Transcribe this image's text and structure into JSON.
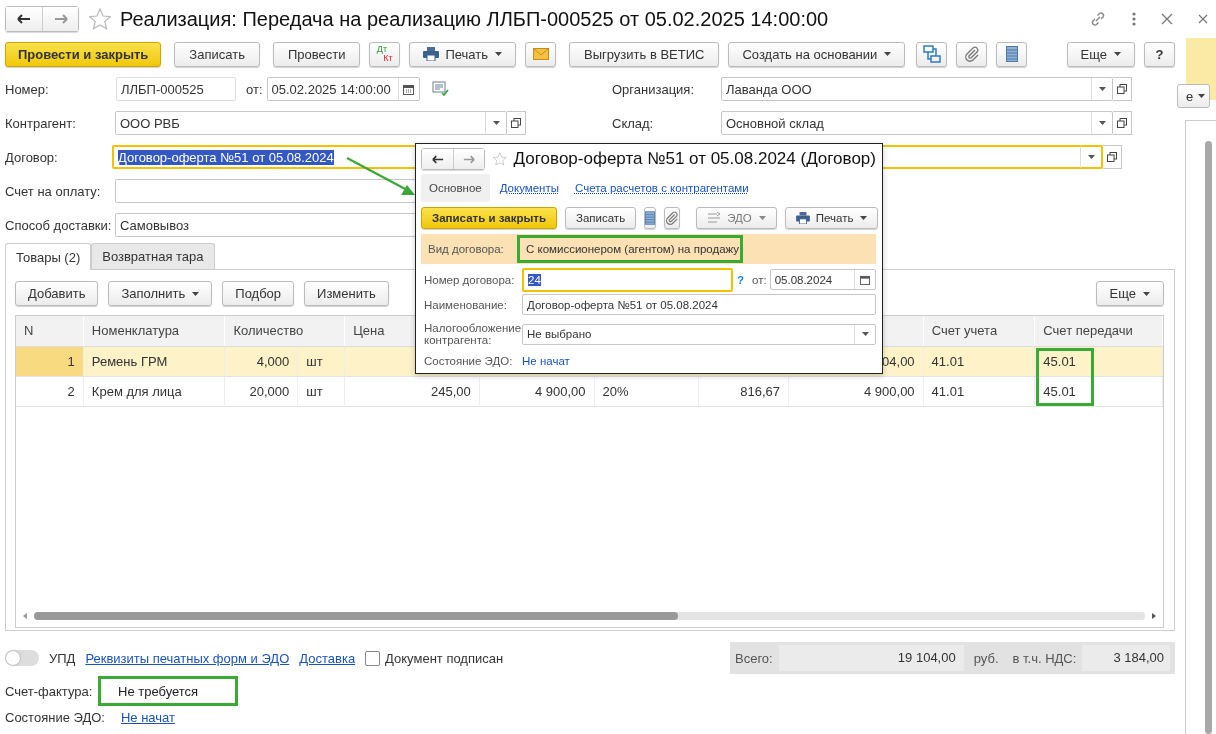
{
  "window": {
    "title": "Реализация: Передача на реализацию ЛЛБП-000525 от 05.02.2025 14:00:00"
  },
  "toolbar": [
    {
      "kind": "primary",
      "label": "Провести и закрыть"
    },
    {
      "kind": "button",
      "label": "Записать"
    },
    {
      "kind": "button",
      "label": "Провести"
    },
    {
      "kind": "dtkt",
      "label": "Дт",
      "label_2": "Кт"
    },
    {
      "kind": "print",
      "label": "Печать"
    },
    {
      "kind": "mail"
    },
    {
      "kind": "button",
      "label": "Выгрузить в ВЕТИС"
    },
    {
      "kind": "menu",
      "label": "Создать на основании"
    },
    {
      "kind": "structure"
    },
    {
      "kind": "clip"
    },
    {
      "kind": "list"
    }
  ],
  "toolbar_right": [
    {
      "kind": "menu",
      "label": "Еще"
    },
    {
      "kind": "button",
      "label": "?"
    }
  ],
  "header": {
    "number": {
      "label": "Номер:",
      "value": "ЛЛБП-000525"
    },
    "date": {
      "label": "от:",
      "value": "05.02.2025 14:00:00"
    },
    "counterparty": {
      "label": "Контрагент:",
      "value": "ООО РВБ"
    },
    "contract": {
      "label": "Договор:",
      "value": "Договор-оферта №51 от 05.08.2024",
      "focused": true,
      "text_selected": true
    },
    "invoice": {
      "label": "Счет на оплату:"
    },
    "delivery": {
      "label": "Способ доставки:",
      "value": "Самовывоз"
    },
    "organization": {
      "label": "Организация:",
      "value": "Лаванда ООО"
    },
    "warehouse": {
      "label": "Склад:",
      "value": "Основной склад"
    }
  },
  "tabs": [
    {
      "label": "Товары (2)",
      "selected": true
    },
    {
      "label": "Возвратная тара",
      "selected": false
    }
  ],
  "table_toolbar": [
    {
      "kind": "button",
      "label": "Добавить"
    },
    {
      "kind": "menu",
      "label": "Заполнить"
    },
    {
      "kind": "button",
      "label": "Подбор"
    },
    {
      "kind": "button",
      "label": "Изменить"
    }
  ],
  "table_toolbar_right": [
    {
      "kind": "menu",
      "label": "Еще"
    }
  ],
  "table": {
    "columns": [
      {
        "label": "N",
        "kind": "single"
      },
      {
        "label": "Номенклатура",
        "kind": "single"
      },
      {
        "label": "Количество",
        "kind": "double"
      },
      {
        "kind": "unit"
      },
      {
        "label": "Цена",
        "kind": "single"
      },
      {
        "kind": "single"
      },
      {
        "kind": "single"
      },
      {
        "kind": "single"
      },
      {
        "kind": "single"
      },
      {
        "label": "Счет учета",
        "kind": "single"
      },
      {
        "label": "Счет передачи",
        "kind": "single",
        "marked": true
      }
    ],
    "rows": [
      {
        "selected": true,
        "cells": [
          "1",
          "Ремень ГРМ",
          "4,000",
          "шт",
          null,
          null,
          null,
          null,
          "04,00",
          "41.01",
          "45.01"
        ]
      },
      {
        "selected": false,
        "cells": [
          "2",
          "Крем для лица",
          "20,000",
          "шт",
          "245,00",
          "4 900,00",
          "20%",
          "816,67",
          "4 900,00",
          "41.01",
          "45.01"
        ]
      }
    ]
  },
  "footer": {
    "upd": {
      "label": "УПД",
      "on": false
    },
    "links": [
      "Реквизиты печатных форм и ЭДО",
      "Доставка"
    ],
    "signed": {
      "label": "Документ подписан",
      "checked": false
    },
    "totals": {
      "label": "Всего:",
      "value": "19 104,00",
      "currency": "руб.",
      "vat_label": "в т.ч. НДС:",
      "vat": "3 184,00"
    },
    "invoice": {
      "label": "Счет-фактура:",
      "value": "Не требуется",
      "marked": true
    },
    "edo": {
      "label": "Состояние ЭДО:",
      "value": "Не начат"
    }
  },
  "popup": {
    "title": "Договор-оферта №51 от 05.08.2024 (Договор)",
    "tabs": [
      {
        "label": "Основное",
        "selected": true
      },
      {
        "label": "Документы",
        "selected": false
      },
      {
        "label": "Счета расчетов с контрагентами",
        "selected": false
      }
    ],
    "toolbar": [
      {
        "kind": "primary",
        "label": "Записать и закрыть"
      },
      {
        "kind": "button",
        "label": "Записать"
      },
      {
        "kind": "list"
      },
      {
        "kind": "clip"
      },
      {
        "kind": "edo",
        "label": "ЭДО"
      },
      {
        "kind": "print",
        "label": "Печать"
      }
    ],
    "kind_field": {
      "label": "Вид договора:",
      "value": "С комиссионером (агентом) на продажу",
      "marked": true
    },
    "number": {
      "label": "Номер договора:",
      "value": "24",
      "focused": true,
      "text_selected": true,
      "help": "?"
    },
    "date": {
      "label": "от:",
      "value": "05.08.2024"
    },
    "name": {
      "label": "Наименование:",
      "value": "Договор-оферта №51 от 05.08.2024"
    },
    "tax": {
      "label": "Налогообложение контрагента:",
      "value": "Не выбрано"
    },
    "edo": {
      "label": "Состояние ЭДО:",
      "value": "Не начат"
    }
  },
  "side_window": {
    "button": "е"
  }
}
